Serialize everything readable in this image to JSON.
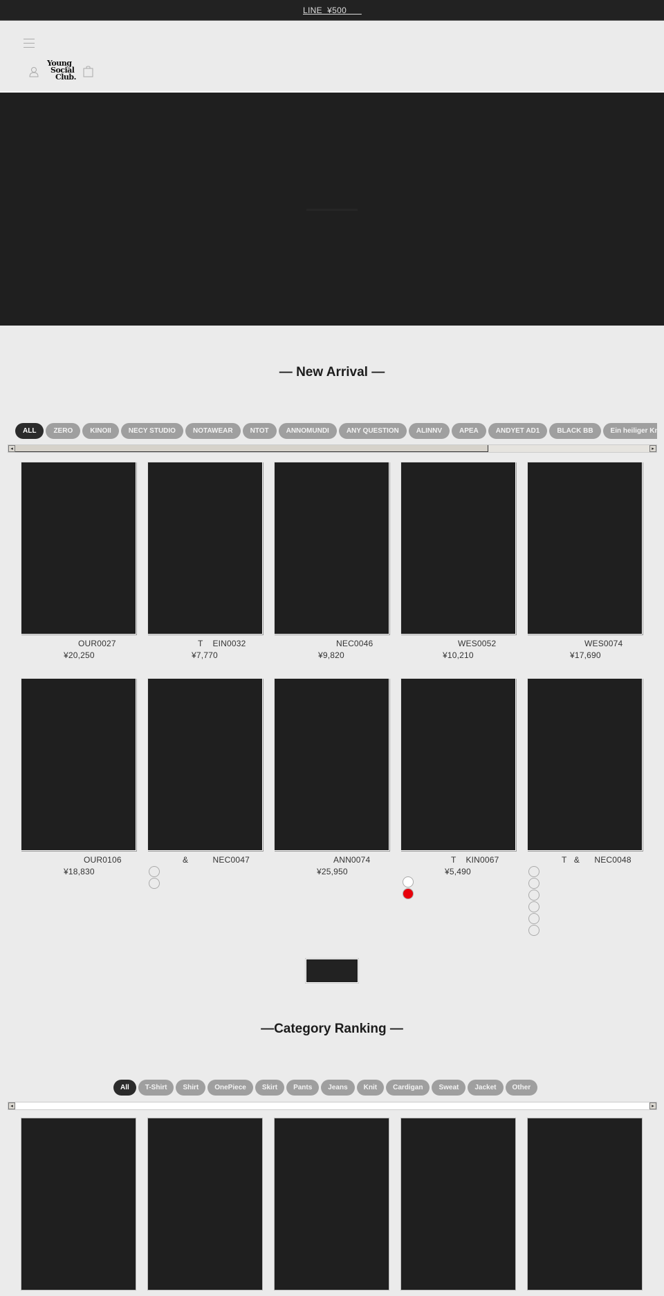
{
  "announcement": {
    "text": "LINE  ¥500      "
  },
  "header": {
    "logo_lines": [
      "Young",
      "Social",
      "Club."
    ],
    "icons": [
      "menu-icon",
      "user-icon",
      "shopping-bag-icon"
    ]
  },
  "new_arrival": {
    "title": "— New Arrival —",
    "brand_tabs": [
      "ALL",
      "ZERO",
      "KINOII",
      "NECY STUDIO",
      "NOTAWEAR",
      "NTOT",
      "ANNOMUNDI",
      "ANY QUESTION",
      "ALINNV",
      "APEA",
      "ANDYET AD1",
      "BLACK BB",
      "Ein heiliger Knot"
    ],
    "active_tab": 0,
    "products": [
      {
        "name": "OUR0027",
        "price": "¥20,250"
      },
      {
        "name": "T    EIN0032",
        "price": "¥7,770"
      },
      {
        "name": "NEC0046",
        "price": "¥9,820"
      },
      {
        "name": "WES0052",
        "price": "¥10,210"
      },
      {
        "name": "WES0074",
        "price": "¥17,690"
      },
      {
        "name": "OUR0106",
        "price": "¥18,830"
      },
      {
        "name": "&          NEC0047",
        "price": ""
      },
      {
        "name": "ANN0074",
        "price": "¥25,950"
      },
      {
        "name": "T    KIN0067",
        "price": "¥5,490"
      },
      {
        "name": "T   &      NEC0048",
        "price": ""
      }
    ],
    "swatches": {
      "6": [
        "#ebebeb",
        "#ebebeb"
      ],
      "8": [
        "#ffffff",
        "#e8000b"
      ],
      "9": [
        "#ebebeb",
        "#ebebeb",
        "#ebebeb",
        "#ebebeb",
        "#ebebeb",
        "#ebebeb"
      ]
    },
    "more_button_label": ""
  },
  "category_ranking": {
    "title": "—Category Ranking —",
    "category_tabs": [
      "All",
      "T-Shirt",
      "Shirt",
      "OnePiece",
      "Skirt",
      "Pants",
      "Jeans",
      "Knit",
      "Cardigan",
      "Sweat",
      "Jacket",
      "Other"
    ],
    "active_tab": 0
  }
}
